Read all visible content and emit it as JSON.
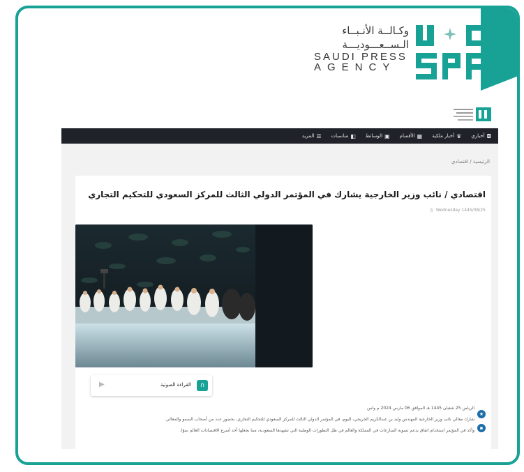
{
  "logo": {
    "arabic_line1": "وكـالــة الأنـبــاء",
    "arabic_line2": "الـســعـــوديـــة",
    "english_line1": "SAUDI PRESS",
    "english_line2": "AGENCY",
    "mark_text": "SPA"
  },
  "nav": {
    "items": [
      {
        "label": "أخباري",
        "icon": "square-icon"
      },
      {
        "label": "أخبار ملكية",
        "icon": "crown-icon"
      },
      {
        "label": "الأقسام",
        "icon": "grid-icon"
      },
      {
        "label": "الوسائط",
        "icon": "media-icon"
      },
      {
        "label": "مناسبات",
        "icon": "events-icon"
      },
      {
        "label": "المزيد",
        "icon": "menu-icon"
      }
    ]
  },
  "breadcrumb": {
    "text": "الرئيسية / اقتصادي"
  },
  "article": {
    "headline": "اقتصادي / نائب وزير الخارجية يشارك في المؤتمر الدولي الثالث للمركز السعودي للتحكيم التجاري",
    "meta": "Wednesday 1445/08/25"
  },
  "audio": {
    "label": "القراءة الصوتية"
  },
  "body": {
    "dateline": "الرياض 25 شعبان 1445 هـ الموافق 06 مارس 2024 م واس",
    "line1": "شارك معالي نائب وزير الخارجية المهندس وليد بن عبدالكريم الخريجي، اليوم، في المؤتمر الدولي الثالث للمركز السعودي للتحكيم التجاري، بحضور عدد من أصحاب السمو والمعالي.",
    "line2": "وأكد في المؤتمر استخدام اتفاق يدعم تسوية المنازعات في المملكة والعالم في ظل التطورات الوطنية التي تشهدها السعودية، مما يجعلها أحد أسرع الاقتصادات العالم نموًا."
  },
  "colors": {
    "brand_teal": "#17a295",
    "nav_dark": "#1f2229",
    "link_blue": "#1d6ea8"
  }
}
